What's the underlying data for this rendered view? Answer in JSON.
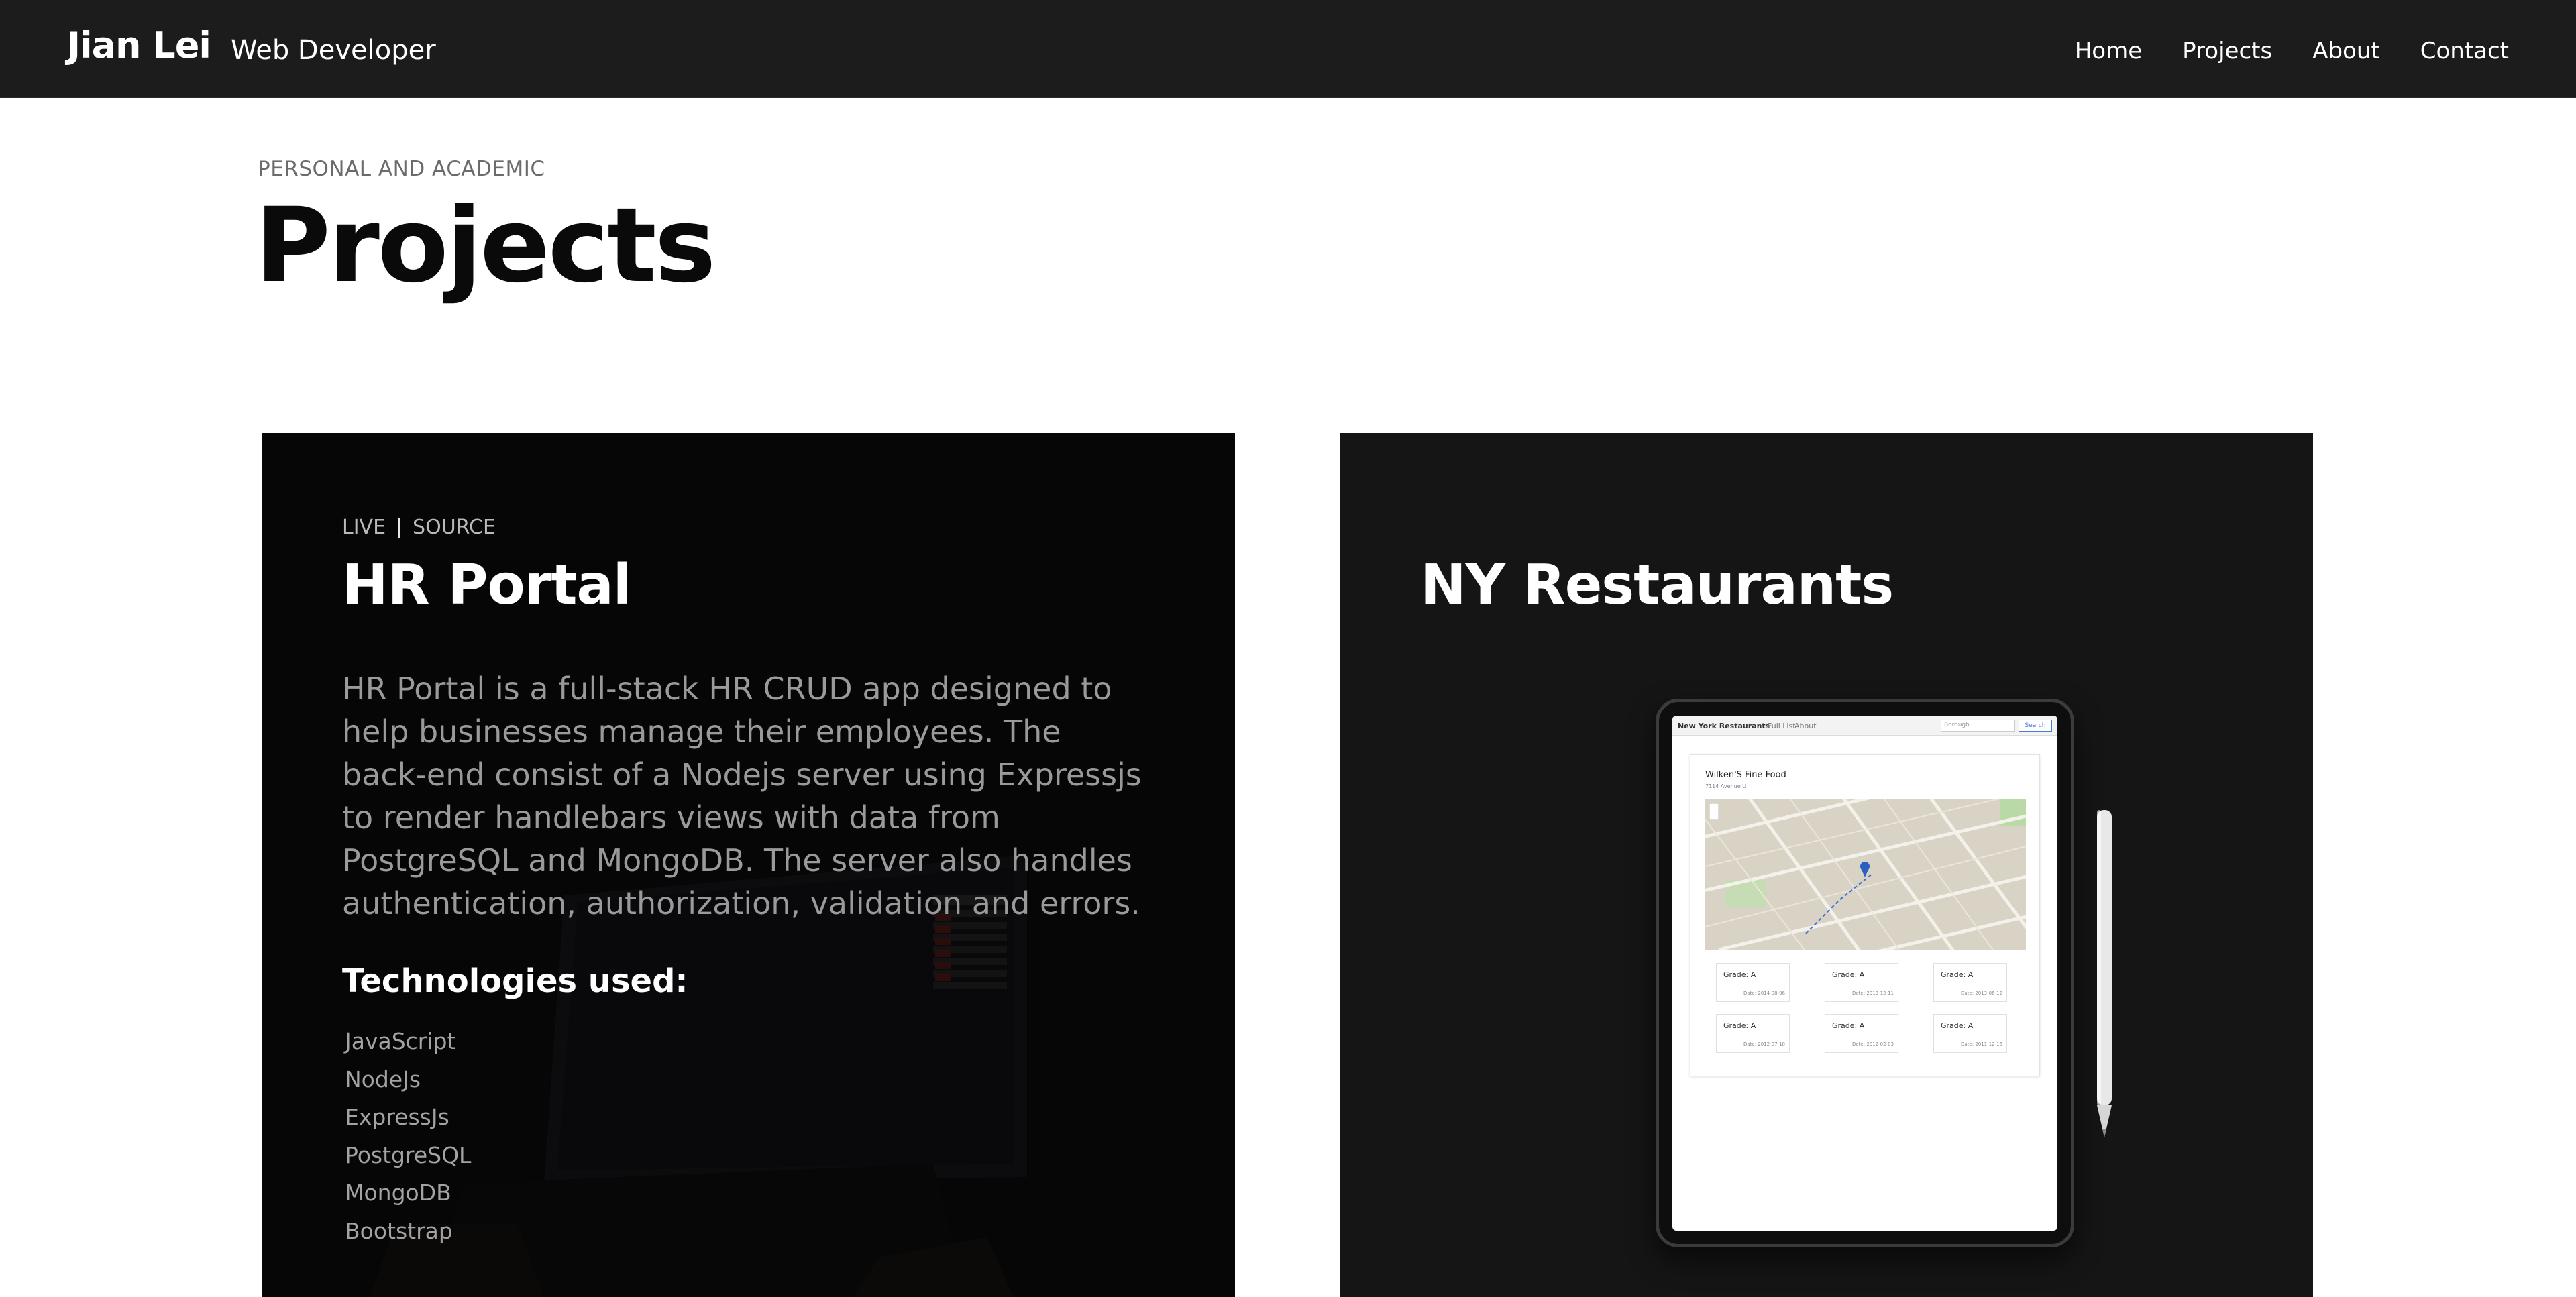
{
  "header": {
    "brand": "Jian Lei",
    "tagline": "Web Developer",
    "nav": [
      "Home",
      "Projects",
      "About",
      "Contact"
    ]
  },
  "page": {
    "eyebrow": "PERSONAL AND ACADEMIC",
    "title": "Projects"
  },
  "projects": [
    {
      "links": [
        "LIVE",
        "SOURCE"
      ],
      "title": "HR Portal",
      "description": "HR Portal is a full-stack HR CRUD app designed to help businesses manage their employees. The back-end consist of a Nodejs server using Expressjs to render handlebars views with data from PostgreSQL and MongoDB. The server also handles authentication, authorization, validation and errors.",
      "technologies_heading": "Technologies used:",
      "technologies": [
        "JavaScript",
        "NodeJs",
        "ExpressJs",
        "PostgreSQL",
        "MongoDB",
        "Bootstrap"
      ]
    },
    {
      "title": "NY Restaurants",
      "screenshot": {
        "nav_brand": "New York Restaurants",
        "nav_links": [
          "Full List",
          "About"
        ],
        "search_placeholder": "Borough",
        "search_button": "Search",
        "restaurant_name": "Wilken'S Fine Food",
        "restaurant_address": "7114 Avenue U",
        "grades": [
          {
            "grade": "Grade: A",
            "date": "Date: 2014-08-06"
          },
          {
            "grade": "Grade: A",
            "date": "Date: 2013-12-11"
          },
          {
            "grade": "Grade: A",
            "date": "Date: 2013-06-12"
          },
          {
            "grade": "Grade: A",
            "date": "Date: 2012-07-18"
          },
          {
            "grade": "Grade: A",
            "date": "Date: 2012-02-03"
          },
          {
            "grade": "Grade: A",
            "date": "Date: 2011-12-16"
          }
        ]
      }
    }
  ],
  "colors": {
    "navbar_bg": "#1c1c1c",
    "card_bg": "#060606",
    "body_text_muted": "#9a9a9a",
    "map_accent": "#3a6fd8"
  }
}
